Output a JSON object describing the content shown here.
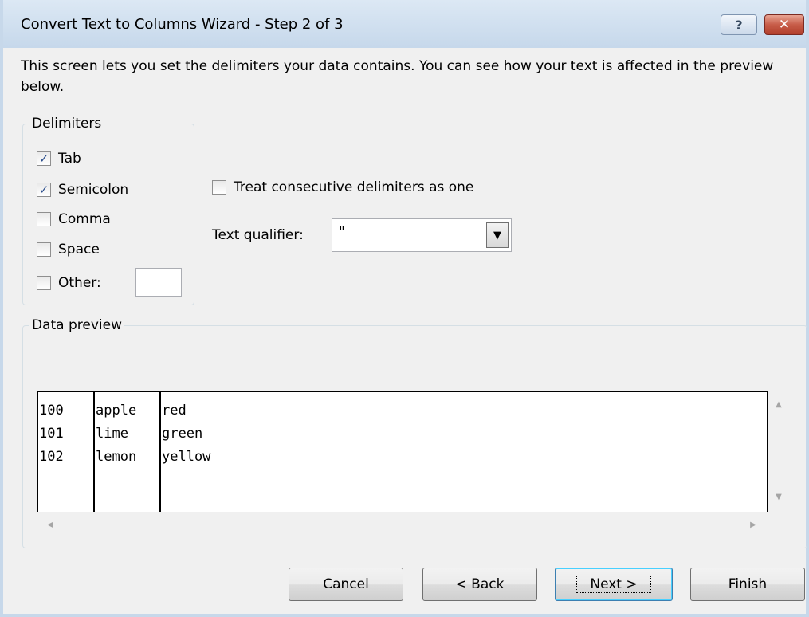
{
  "window": {
    "title": "Convert Text to Columns Wizard - Step 2 of 3",
    "help_label": "?",
    "close_label": "✕"
  },
  "instructions": "This screen lets you set the delimiters your data contains.  You can see how your text is affected in the preview below.",
  "delimiters": {
    "legend": "Delimiters",
    "items": [
      {
        "label": "Tab",
        "checked": true,
        "check": "✓"
      },
      {
        "label": "Semicolon",
        "checked": true,
        "check": "✓"
      },
      {
        "label": "Comma",
        "checked": false,
        "check": ""
      },
      {
        "label": "Space",
        "checked": false,
        "check": ""
      },
      {
        "label": "Other:",
        "checked": false,
        "check": ""
      }
    ],
    "other_value": ""
  },
  "options": {
    "treat_consecutive_label": "Treat consecutive delimiters as one",
    "treat_consecutive_checked": false,
    "text_qualifier_label": "Text qualifier:",
    "text_qualifier_value": "\""
  },
  "preview": {
    "legend": "Data preview",
    "columns": [
      [
        "100",
        "101",
        "102"
      ],
      [
        "apple",
        "lime",
        "lemon"
      ],
      [
        "red",
        "green",
        "yellow"
      ]
    ]
  },
  "buttons": {
    "cancel": "Cancel",
    "back": "< Back",
    "next": "Next >",
    "finish": "Finish"
  }
}
